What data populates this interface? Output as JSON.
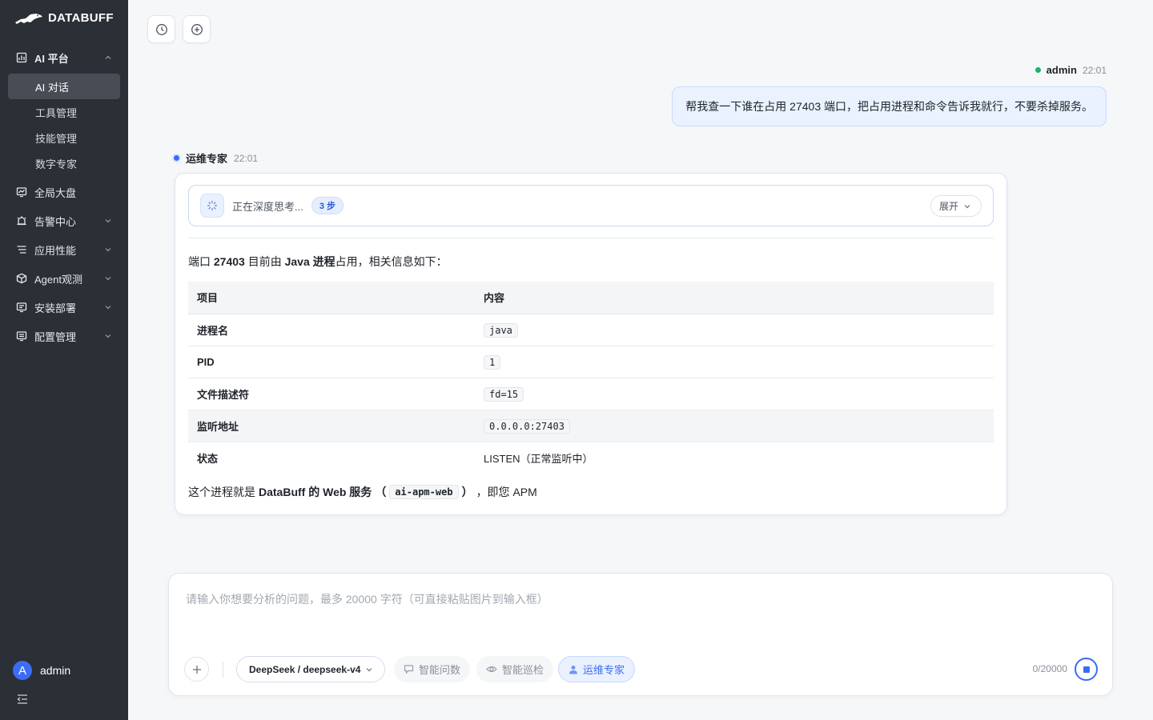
{
  "app": {
    "logo_text": "DATABUFF"
  },
  "sidebar": {
    "sections": [
      {
        "label": "AI 平台",
        "icon": "chart-icon",
        "expanded": true
      },
      {
        "label": "全局大盘",
        "icon": "dashboard-icon"
      },
      {
        "label": "告警中心",
        "icon": "alarm-icon"
      },
      {
        "label": "应用性能",
        "icon": "list-icon"
      },
      {
        "label": "Agent观测",
        "icon": "cube-icon"
      },
      {
        "label": "安装部署",
        "icon": "deploy-icon"
      },
      {
        "label": "配置管理",
        "icon": "config-icon"
      }
    ],
    "sub_items": [
      {
        "label": "AI 对话",
        "active": true
      },
      {
        "label": "工具管理"
      },
      {
        "label": "技能管理"
      },
      {
        "label": "数字专家"
      }
    ],
    "user": {
      "avatar_letter": "A",
      "name": "admin"
    }
  },
  "user_message": {
    "name": "admin",
    "time": "22:01",
    "text": "帮我查一下谁在占用 27403 端口，把占用进程和命令告诉我就行，不要杀掉服务。"
  },
  "agent_message": {
    "name": "运维专家",
    "time": "22:01",
    "thinking_text": "正在深度思考...",
    "steps_badge": "3 步",
    "expand_label": "展开",
    "intro": {
      "p1": "端口 ",
      "port": "27403",
      "p2": " 目前由 ",
      "proc": "Java 进程",
      "p3": "占用，相关信息如下："
    },
    "table": {
      "headers": [
        "项目",
        "内容"
      ],
      "rows": [
        {
          "key": "进程名",
          "value": "java",
          "code": true
        },
        {
          "key": "PID",
          "value": "1",
          "code": true
        },
        {
          "key": "文件描述符",
          "value": "fd=15",
          "code": true
        },
        {
          "key": "监听地址",
          "value": "0.0.0.0:27403",
          "code": true
        },
        {
          "key": "状态",
          "value": "LISTEN（正常监听中）",
          "code": false
        }
      ]
    },
    "outro": {
      "p1": "这个进程就是 ",
      "bold": "DataBuff 的 Web 服务",
      "open": "（",
      "code": "ai-apm-web",
      "close": "）",
      "p2": "，即您 APM"
    }
  },
  "composer": {
    "placeholder": "请输入你想要分析的问题，最多 20000 字符（可直接粘贴图片到输入框）",
    "model": "DeepSeek / deepseek-v4",
    "modes": [
      {
        "label": "智能问数",
        "icon": "chat-icon"
      },
      {
        "label": "智能巡检",
        "icon": "eye-icon"
      },
      {
        "label": "运维专家",
        "icon": "person-icon",
        "active": true
      }
    ],
    "counter": "0/20000"
  },
  "colors": {
    "sidebar_bg": "#2b2f36",
    "accent": "#3b6cf6",
    "online": "#19b36b"
  }
}
